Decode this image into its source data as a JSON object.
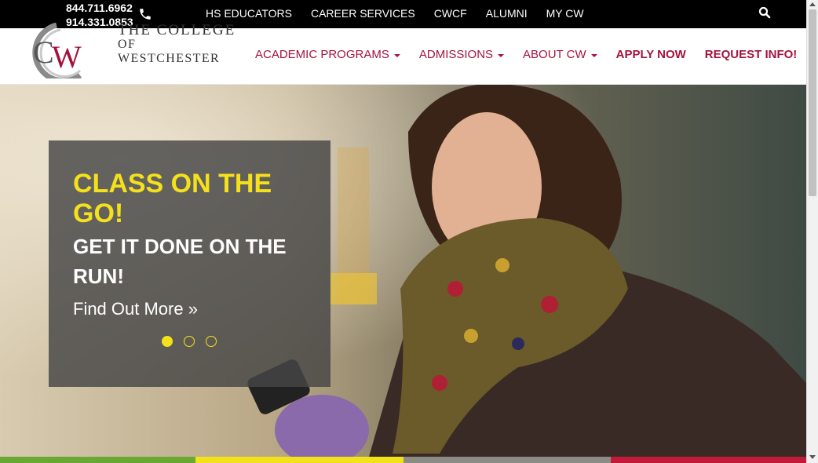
{
  "topbar": {
    "phone1": "844.711.6962",
    "phone2": "914.331.0853",
    "links": [
      "HS EDUCATORS",
      "CAREER SERVICES",
      "CWCF",
      "ALUMNI",
      "MY CW"
    ]
  },
  "header": {
    "logo_monogram": "CW",
    "logo_line1": "THE COLLEGE",
    "logo_line2": "OF WESTCHESTER",
    "nav": {
      "academic_programs": "ACADEMIC PROGRAMS",
      "admissions": "ADMISSIONS",
      "about": "ABOUT CW",
      "apply": "APPLY NOW",
      "request": "REQUEST INFO!"
    }
  },
  "hero": {
    "headline": "CLASS ON THE GO!",
    "subheadline": "GET IT DONE ON THE RUN!",
    "cta": "Find Out More »",
    "slides_total": 3,
    "active_slide": 1
  },
  "colors": {
    "brand_red": "#a6113c",
    "accent_yellow": "#f5e11b",
    "strip": [
      "#6aa834",
      "#f2e21a",
      "#8c8c86",
      "#c41a3a"
    ]
  },
  "icons": {
    "phone": "phone-icon",
    "search": "search-icon"
  }
}
